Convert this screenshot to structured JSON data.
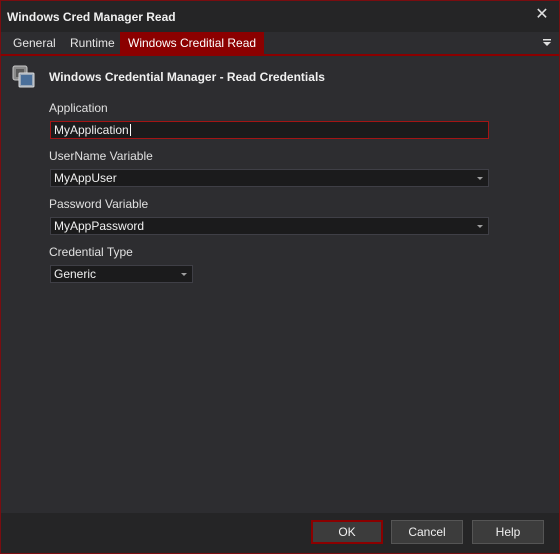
{
  "window": {
    "title": "Windows Cred Manager Read",
    "close_glyph": "✕"
  },
  "tabs": [
    {
      "label": "General"
    },
    {
      "label": "Runtime"
    },
    {
      "label": "Windows Creditial Read",
      "active": true
    }
  ],
  "header": {
    "icon": "credential-manager-icon",
    "title": "Windows Credential Manager - Read Credentials"
  },
  "form": {
    "application": {
      "label": "Application",
      "value": "MyApplication"
    },
    "username_variable": {
      "label": "UserName Variable",
      "value": "MyAppUser"
    },
    "password_variable": {
      "label": "Password Variable",
      "value": "MyAppPassword"
    },
    "credential_type": {
      "label": "Credential Type",
      "value": "Generic"
    }
  },
  "buttons": {
    "ok": "OK",
    "cancel": "Cancel",
    "help": "Help"
  },
  "colors": {
    "accent": "#8b0000",
    "background": "#2d2d30",
    "field": "#1b1b1c"
  }
}
